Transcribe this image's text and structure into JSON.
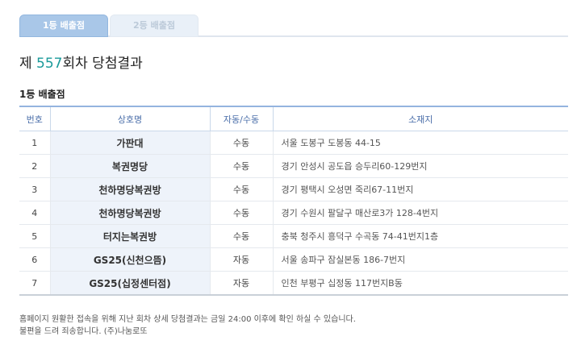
{
  "tabs": [
    {
      "label": "1등 배출점",
      "active": true
    },
    {
      "label": "2등 배출점",
      "active": false
    }
  ],
  "title": {
    "prefix": "제 ",
    "round": "557",
    "suffix": "회차 당첨결과"
  },
  "section_title": "1등 배출점",
  "table": {
    "headers": [
      "번호",
      "상호명",
      "자동/수동",
      "소재지"
    ],
    "rows": [
      {
        "no": "1",
        "name": "가판대",
        "type": "수동",
        "address": "서울 도봉구 도봉동 44-15"
      },
      {
        "no": "2",
        "name": "복권명당",
        "type": "수동",
        "address": "경기 안성시 공도읍 승두리60-129번지"
      },
      {
        "no": "3",
        "name": "천하명당복권방",
        "type": "수동",
        "address": "경기 평택시 오성면 죽리67-11번지"
      },
      {
        "no": "4",
        "name": "천하명당복권방",
        "type": "수동",
        "address": "경기 수원시 팔달구 매산로3가 128-4번지"
      },
      {
        "no": "5",
        "name": "터지는복권방",
        "type": "수동",
        "address": "충북 청주시 흥덕구 수곡동 74-41번지1층"
      },
      {
        "no": "6",
        "name": "GS25(신천으뜸)",
        "type": "자동",
        "address": "서울 송파구 잠실본동 186-7번지"
      },
      {
        "no": "7",
        "name": "GS25(십정센터점)",
        "type": "자동",
        "address": "인천 부평구 십정동 117번지B동"
      }
    ]
  },
  "notice": {
    "line1": "홈페이지 원활한 접속을 위해 지난 회차 상세 당첨결과는 금일 24:00 이후에 확인 하실 수 있습니다.",
    "line2": "불편을 드려 죄송합니다. (주)나눔로또"
  }
}
